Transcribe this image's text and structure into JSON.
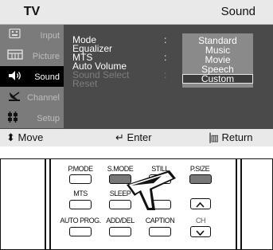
{
  "header": {
    "tv_label": "TV",
    "menu_title": "Sound"
  },
  "sidebar": {
    "items": [
      {
        "label": "Input",
        "icon": "input-icon",
        "active": false
      },
      {
        "label": "Picture",
        "icon": "picture-icon",
        "active": false
      },
      {
        "label": "Sound",
        "icon": "speaker-icon",
        "active": true
      },
      {
        "label": "Channel",
        "icon": "satellite-dish-icon",
        "active": false
      },
      {
        "label": "Setup",
        "icon": "setup-icon",
        "active": false
      }
    ]
  },
  "menu": {
    "options": [
      {
        "label": "Mode",
        "dim": false
      },
      {
        "label": "Equalizer",
        "dim": false
      },
      {
        "label": "MTS",
        "dim": false
      },
      {
        "label": "Auto Volume",
        "dim": false
      },
      {
        "label": "Sound Select",
        "dim": true
      },
      {
        "label": "Reset",
        "dim": true
      }
    ],
    "colon": ":"
  },
  "dropdown": {
    "items": [
      "Standard",
      "Music",
      "Movie",
      "Speech",
      "Custom"
    ],
    "selected": "Custom"
  },
  "footer": {
    "move": "Move",
    "enter": "Enter",
    "return": "Return"
  },
  "remote": {
    "row1": [
      "P.MODE",
      "S.MODE",
      "STILL",
      "P.SIZE"
    ],
    "row2": [
      "MTS",
      "SLEEP"
    ],
    "row3": [
      "AUTO PROG.",
      "ADD/DEL",
      "CAPTION",
      "CH"
    ],
    "highlighted": "S.MODE"
  },
  "colors": {
    "osd_bg": "#4a4a4a",
    "bar_bg": "#e9e9e9",
    "sidebar_bg": "#7b7b7b",
    "dropdown_bg": "#8a8a8a"
  }
}
